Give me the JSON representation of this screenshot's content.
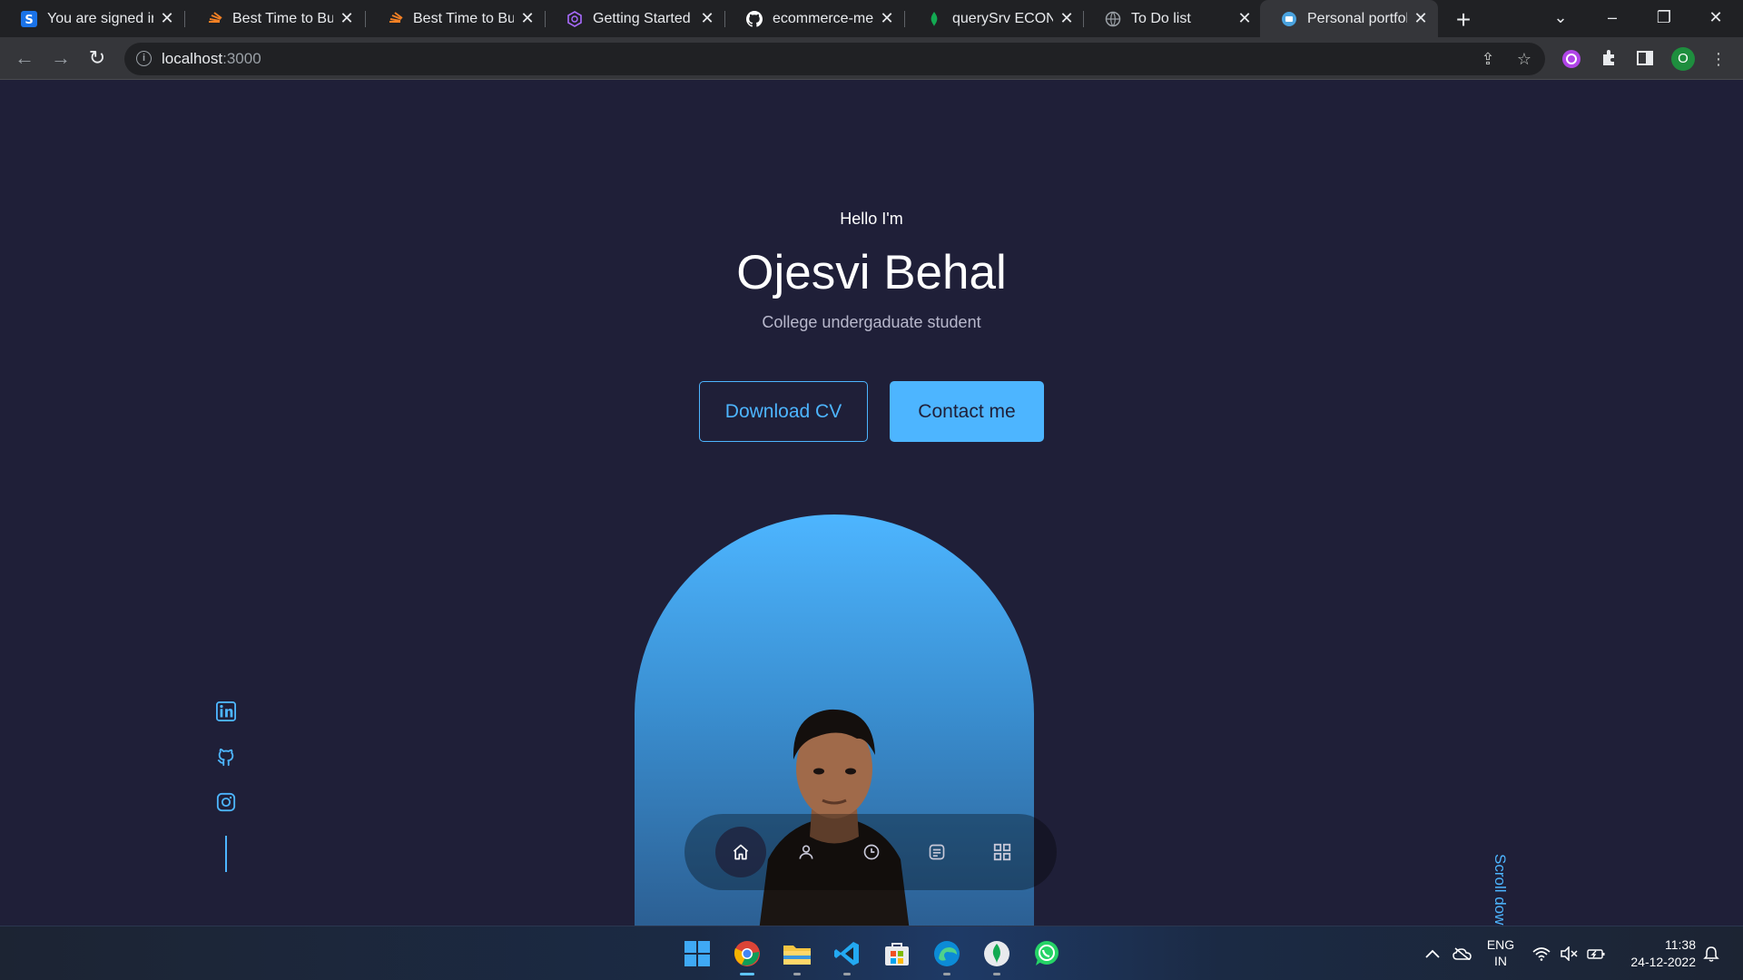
{
  "browser": {
    "tabs": [
      {
        "title": "You are signed in",
        "icon": "s-logo-icon",
        "active": false
      },
      {
        "title": "Best Time to Buy",
        "icon": "stackoverflow-icon",
        "active": false
      },
      {
        "title": "Best Time to Buy",
        "icon": "stackoverflow-icon",
        "active": false
      },
      {
        "title": "Getting Started w",
        "icon": "graphql-icon",
        "active": false
      },
      {
        "title": "ecommerce-mern",
        "icon": "github-icon",
        "active": false
      },
      {
        "title": "querySrv ECONNI",
        "icon": "mongodb-leaf-icon",
        "active": false
      },
      {
        "title": "To Do list",
        "icon": "globe-icon",
        "active": false
      },
      {
        "title": "Personal portfolio",
        "icon": "portfolio-icon",
        "active": true
      }
    ],
    "new_tab": "+",
    "url_host": "localhost",
    "url_port": ":3000",
    "profile_initial": "O"
  },
  "header": {
    "greeting": "Hello I'm",
    "name": "Ojesvi Behal",
    "subtitle": "College undergaduate student",
    "download_cv": "Download CV",
    "contact_me": "Contact me"
  },
  "socials": [
    {
      "name": "linkedin-icon"
    },
    {
      "name": "github-icon"
    },
    {
      "name": "instagram-icon"
    }
  ],
  "scroll_label": "Scroll down",
  "nav": [
    {
      "name": "home-icon",
      "active": true
    },
    {
      "name": "user-icon",
      "active": false
    },
    {
      "name": "clock-icon",
      "active": false
    },
    {
      "name": "message-icon",
      "active": false
    },
    {
      "name": "grid-icon",
      "active": false
    }
  ],
  "taskbar": {
    "apps": [
      "windows-start-icon",
      "chrome-icon",
      "file-explorer-icon",
      "vscode-icon",
      "microsoft-store-icon",
      "edge-icon",
      "mongodb-compass-icon",
      "whatsapp-icon"
    ],
    "lang_line1": "ENG",
    "lang_line2": "IN",
    "time": "11:38",
    "date": "24-12-2022"
  },
  "colors": {
    "accent": "#4db5ff",
    "background": "#1f1f38"
  }
}
